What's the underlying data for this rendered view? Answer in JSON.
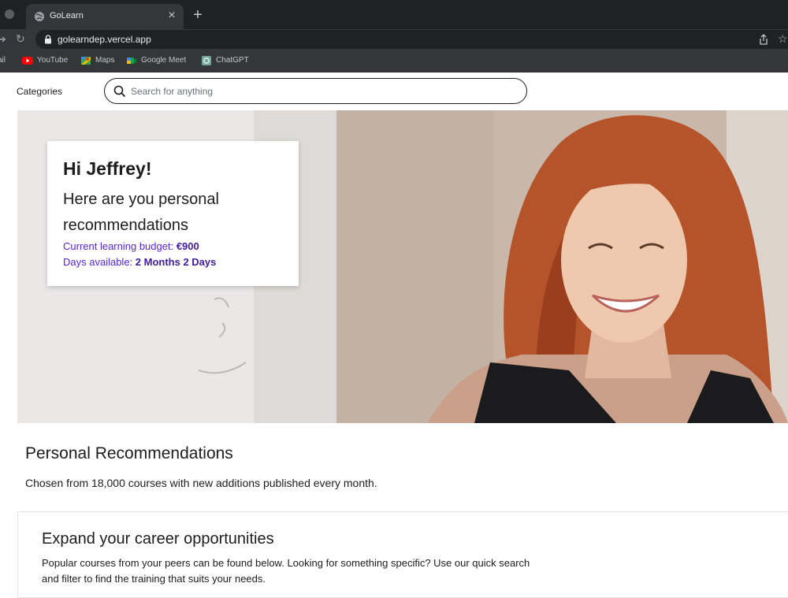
{
  "browser": {
    "tab_title": "GoLearn",
    "tab_close": "×",
    "new_tab": "+",
    "url": "golearndep.vercel.app",
    "bookmarks": [
      {
        "label": "ail",
        "icon": "gmail-icon"
      },
      {
        "label": "YouTube",
        "icon": "youtube-icon",
        "color": "#ff0000"
      },
      {
        "label": "Maps",
        "icon": "maps-icon"
      },
      {
        "label": "Google Meet",
        "icon": "google-meet-icon"
      },
      {
        "label": "ChatGPT",
        "icon": "chatgpt-icon",
        "color": "#74aa9c"
      }
    ]
  },
  "header": {
    "categories_label": "Categories",
    "search_placeholder": "Search for anything"
  },
  "hero": {
    "greeting": "Hi Jeffrey!",
    "subtitle": "Here are you personal recommendations",
    "budget_label": "Current learning budget: ",
    "budget_value": "€900",
    "days_label": "Days available: ",
    "days_value": "2 Months 2 Days",
    "accent_color": "#5624d0"
  },
  "recommendations": {
    "title": "Personal Recommendations",
    "subtitle": "Chosen from 18,000 courses with new additions published every month."
  },
  "career": {
    "title": "Expand your career opportunities",
    "text": "Popular courses from your peers can be found below. Looking for something specific? Use our quick search and filter to find the training that suits your needs."
  }
}
